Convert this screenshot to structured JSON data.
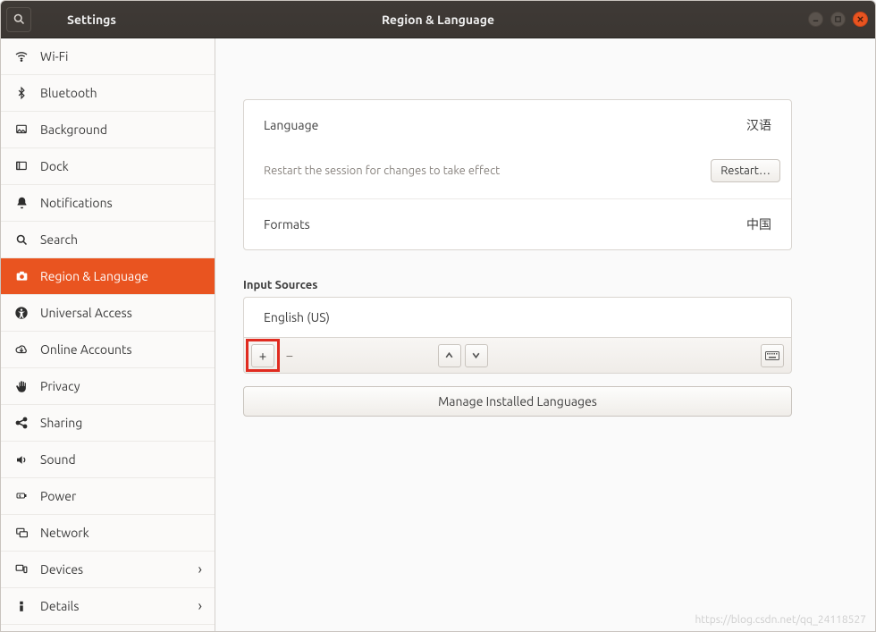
{
  "titlebar": {
    "app_title": "Settings",
    "page_title": "Region & Language"
  },
  "sidebar": {
    "items": [
      {
        "id": "wifi",
        "label": "Wi-Fi",
        "icon": "wifi"
      },
      {
        "id": "bluetooth",
        "label": "Bluetooth",
        "icon": "bluetooth"
      },
      {
        "id": "background",
        "label": "Background",
        "icon": "background"
      },
      {
        "id": "dock",
        "label": "Dock",
        "icon": "dock"
      },
      {
        "id": "notifications",
        "label": "Notifications",
        "icon": "bell"
      },
      {
        "id": "search",
        "label": "Search",
        "icon": "search"
      },
      {
        "id": "region",
        "label": "Region & Language",
        "icon": "camera",
        "active": true
      },
      {
        "id": "universal",
        "label": "Universal Access",
        "icon": "accessibility"
      },
      {
        "id": "online",
        "label": "Online Accounts",
        "icon": "cloud"
      },
      {
        "id": "privacy",
        "label": "Privacy",
        "icon": "hand"
      },
      {
        "id": "sharing",
        "label": "Sharing",
        "icon": "share"
      },
      {
        "id": "sound",
        "label": "Sound",
        "icon": "speaker"
      },
      {
        "id": "power",
        "label": "Power",
        "icon": "battery"
      },
      {
        "id": "network",
        "label": "Network",
        "icon": "network"
      },
      {
        "id": "devices",
        "label": "Devices",
        "icon": "devices",
        "chevron": true
      },
      {
        "id": "details",
        "label": "Details",
        "icon": "info",
        "chevron": true
      }
    ]
  },
  "region": {
    "language_label": "Language",
    "language_value": "汉语",
    "restart_hint": "Restart the session for changes to take effect",
    "restart_button": "Restart…",
    "formats_label": "Formats",
    "formats_value": "中国"
  },
  "input_sources": {
    "heading": "Input Sources",
    "items": [
      "English (US)"
    ],
    "add_label": "+",
    "remove_label": "−",
    "up_label": "up",
    "down_label": "down",
    "keyboard_label": "keyboard"
  },
  "manage": {
    "label": "Manage Installed Languages"
  },
  "watermark": "https://blog.csdn.net/qq_24118527"
}
